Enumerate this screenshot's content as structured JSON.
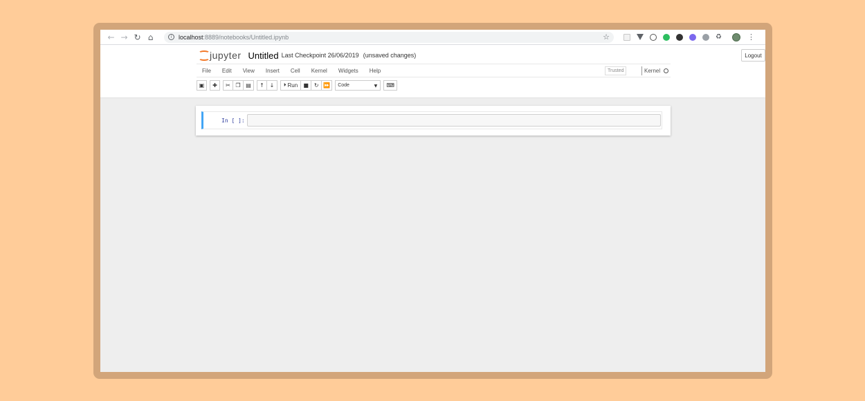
{
  "browser": {
    "host": "localhost",
    "path": ":8889/notebooks/Untitled.ipynb",
    "icons": [
      "back-icon",
      "forward-icon",
      "reload-icon",
      "home-icon",
      "info-icon",
      "star-icon"
    ]
  },
  "jupyter": {
    "logo_text": "jupyter",
    "notebook_name": "Untitled",
    "checkpoint": "Last Checkpoint  26/06/2019",
    "unsaved": "(unsaved changes)",
    "logout_label": "Logout",
    "menu": [
      "File",
      "Edit",
      "View",
      "Insert",
      "Cell",
      "Kernel",
      "Widgets",
      "Help"
    ],
    "trusted_label": "Trusted",
    "kernel_label": "Kernel",
    "run_label": "Run",
    "cell_type": "Code"
  },
  "cell": {
    "prompt": "In [ ]:"
  },
  "colors": {
    "page_bg": "#FFCC99",
    "frame": "#D2A57A",
    "jupyter_orange": "#F37726",
    "cell_selected": "#42A5F5"
  }
}
